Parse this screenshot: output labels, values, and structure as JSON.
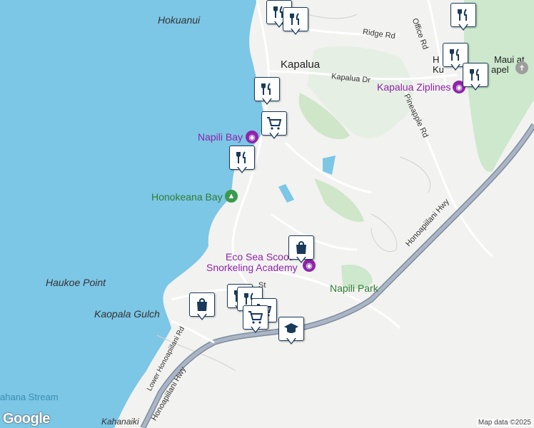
{
  "map": {
    "colors": {
      "water": "#7cc6e6",
      "land": "#f2f2f0",
      "park": "#cde8cd",
      "highway": "#9aa6b6",
      "road": "#ffffff",
      "pin_border": "#1a3a5a",
      "poi_purple": "#8e24aa",
      "park_green": "#2e7d32"
    },
    "place_labels": {
      "hokuanui": "Hokuanui",
      "kapalua": "Kapalua",
      "haukoe_point": "Haukoe Point",
      "kaopala_gulch": "Kaopala Gulch",
      "kahanaiki": "Kahanaiki",
      "kahana_stream": "ahana Stream",
      "maui_at": "Maui at",
      "kukapel": "Ku",
      "chapel": "apel",
      "h_prefix": "H"
    },
    "road_labels": {
      "ridge_rd": "Ridge Rd",
      "office_rd": "Office Rd",
      "kapalua_dr": "Kapalua Dr",
      "pineapple_rd": "Pineapple Rd",
      "honoapiilani_hwy_ne": "Honoapiilani Hwy",
      "honoapiilani_hwy_sw": "Honoapiilani Hwy",
      "lower_honoapiilani_rd": "Lower Honoapiilani Rd",
      "st_fragment": "St"
    },
    "poi_labels": {
      "napili_bay": "Napili Bay",
      "honokeana_bay": "Honokeana Bay",
      "kapalua_ziplines": "Kapalua Ziplines",
      "eco_sea_line1": "Eco Sea Scoot",
      "eco_sea_line2": "Snorkeling Academy",
      "napili_park": "Napili Park"
    },
    "icons": {
      "restaurant": "restaurant-icon",
      "shopping_cart": "shopping-cart-icon",
      "shopping_bag": "shopping-bag-icon",
      "school": "school-icon",
      "camera": "camera-icon",
      "tree": "tree-icon",
      "church": "church-icon"
    },
    "branding": {
      "logo": "Google",
      "attribution": "Map data ©2025"
    }
  }
}
